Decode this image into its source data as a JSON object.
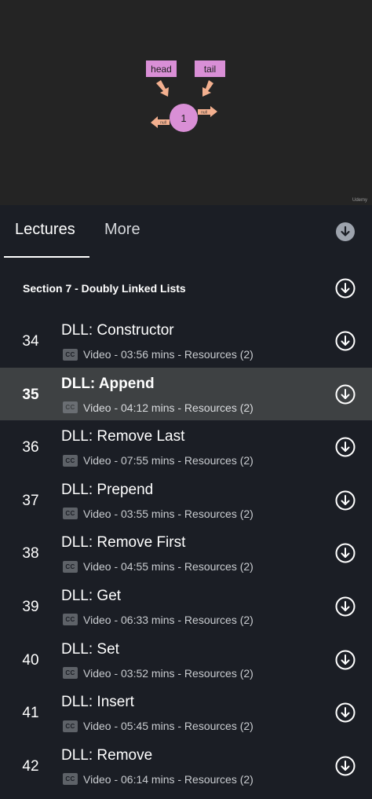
{
  "video": {
    "diagram": {
      "head_label": "head",
      "tail_label": "tail",
      "node_value": "1",
      "null_left": "null",
      "null_right": "null"
    },
    "watermark": "Udemy"
  },
  "tabs": [
    {
      "label": "Lectures",
      "selected": true
    },
    {
      "label": "More",
      "selected": false
    }
  ],
  "section": {
    "title": "Section 7 - Doubly Linked Lists"
  },
  "cc_label": "CC",
  "lectures": [
    {
      "number": "34",
      "title": "DLL: Constructor",
      "meta": "Video - 03:56 mins - Resources (2)",
      "active": false
    },
    {
      "number": "35",
      "title": "DLL: Append",
      "meta": "Video - 04:12 mins - Resources (2)",
      "active": true
    },
    {
      "number": "36",
      "title": "DLL: Remove Last",
      "meta": "Video - 07:55 mins - Resources (2)",
      "active": false
    },
    {
      "number": "37",
      "title": "DLL: Prepend",
      "meta": "Video - 03:55 mins - Resources (2)",
      "active": false
    },
    {
      "number": "38",
      "title": "DLL: Remove First",
      "meta": "Video - 04:55 mins - Resources (2)",
      "active": false
    },
    {
      "number": "39",
      "title": "DLL: Get",
      "meta": "Video - 06:33 mins - Resources (2)",
      "active": false
    },
    {
      "number": "40",
      "title": "DLL: Set",
      "meta": "Video - 03:52 mins - Resources (2)",
      "active": false
    },
    {
      "number": "41",
      "title": "DLL: Insert",
      "meta": "Video - 05:45 mins - Resources (2)",
      "active": false
    },
    {
      "number": "42",
      "title": "DLL: Remove",
      "meta": "Video - 06:14 mins - Resources (2)",
      "active": false
    }
  ],
  "colors": {
    "background": "#1b1e25",
    "video_background": "#242424",
    "active_row": "#3e4143",
    "label_box": "#d98fd6",
    "node_fill": "#d98fd6",
    "arrow": "#f3b08f"
  }
}
